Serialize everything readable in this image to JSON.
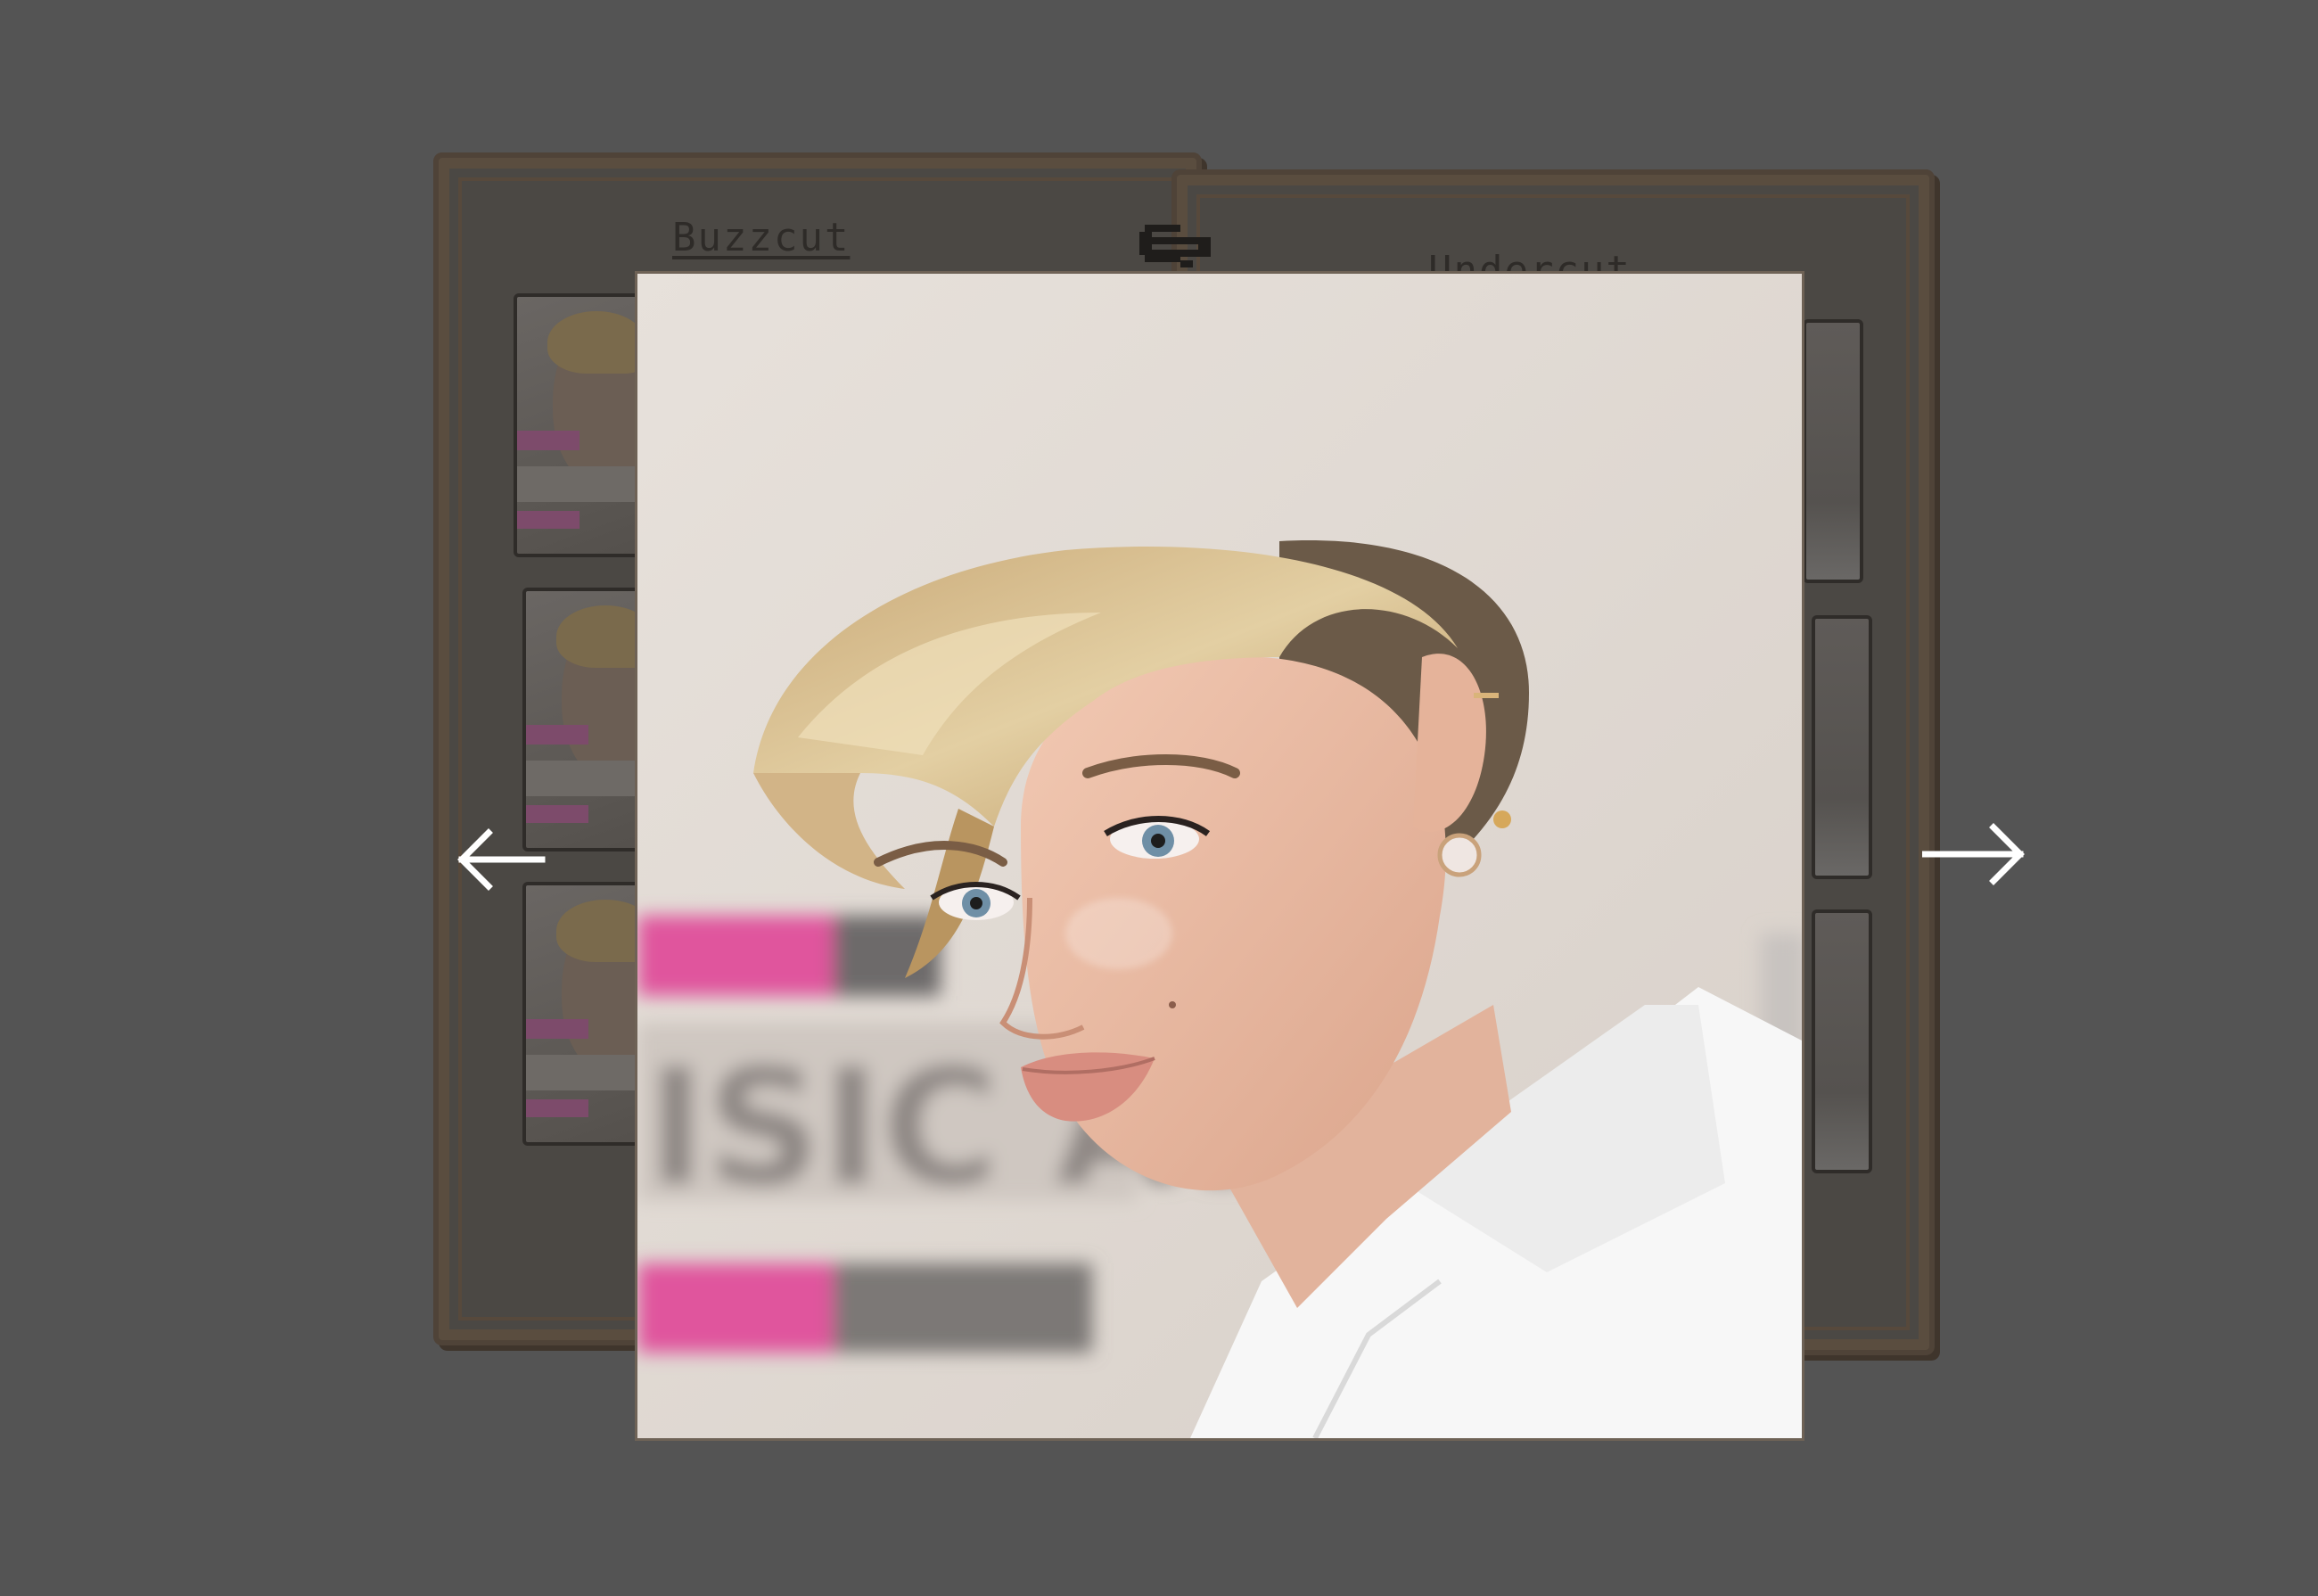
{
  "cards": {
    "left": {
      "title": "Buzzcut"
    },
    "right": {
      "title": "Undercut"
    }
  },
  "lightbox": {
    "image_alt": "Short blonde undercut hairstyle portrait",
    "prev_icon": "arrow-left-icon",
    "next_icon": "arrow-right-icon"
  },
  "colors": {
    "overlay": "#545454",
    "card_border": "#5a4d3f",
    "card_fill": "#4b4844",
    "accent_pink": "#e0559d",
    "arrow": "#ffffff"
  }
}
